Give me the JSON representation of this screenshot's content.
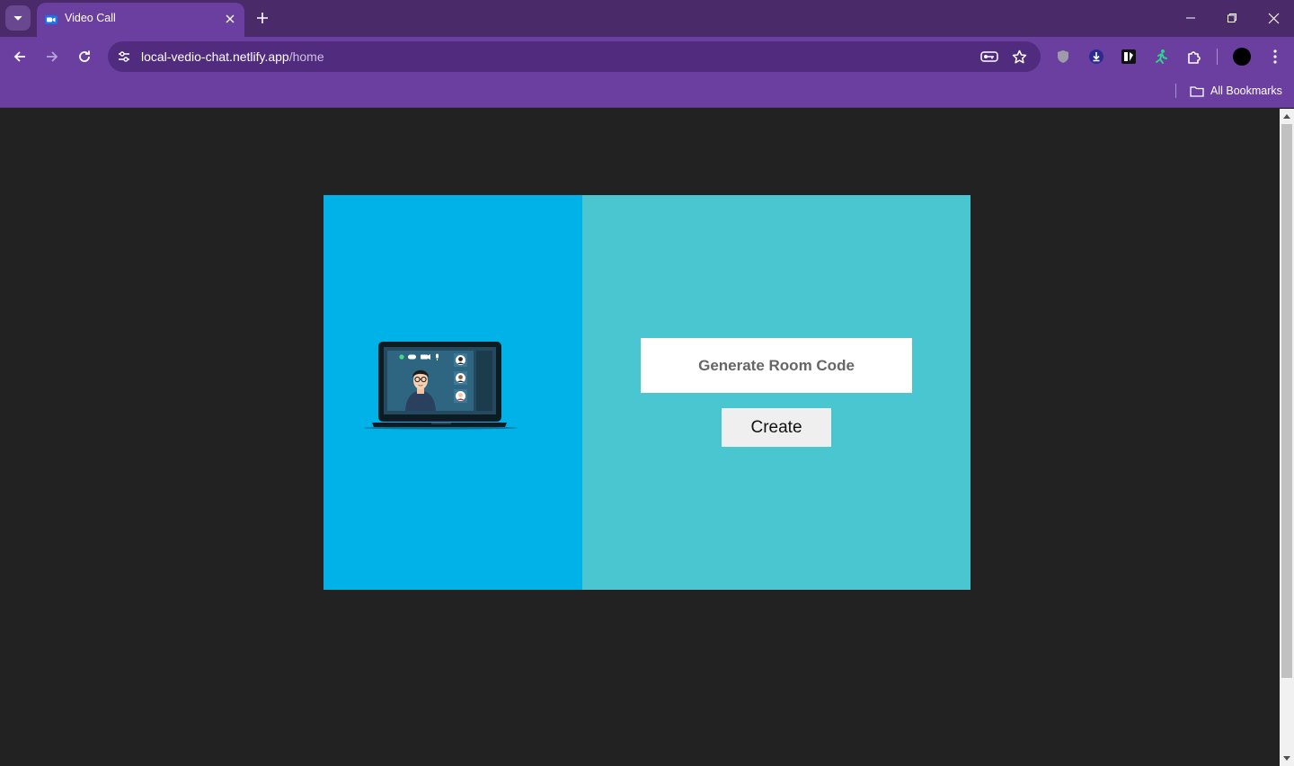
{
  "browser": {
    "tab_title": "Video Call",
    "url_host": "local-vedio-chat.netlify.app",
    "url_path": "/home",
    "bookmarks_label": "All Bookmarks"
  },
  "page": {
    "room_placeholder": "Generate Room Code",
    "room_value": "",
    "create_label": "Create"
  },
  "colors": {
    "chrome_frame": "#4a2a69",
    "chrome_toolbar": "#6b3fa0",
    "page_bg": "#222222",
    "left_panel": "#00b2e7",
    "right_panel": "#49c6d0"
  }
}
